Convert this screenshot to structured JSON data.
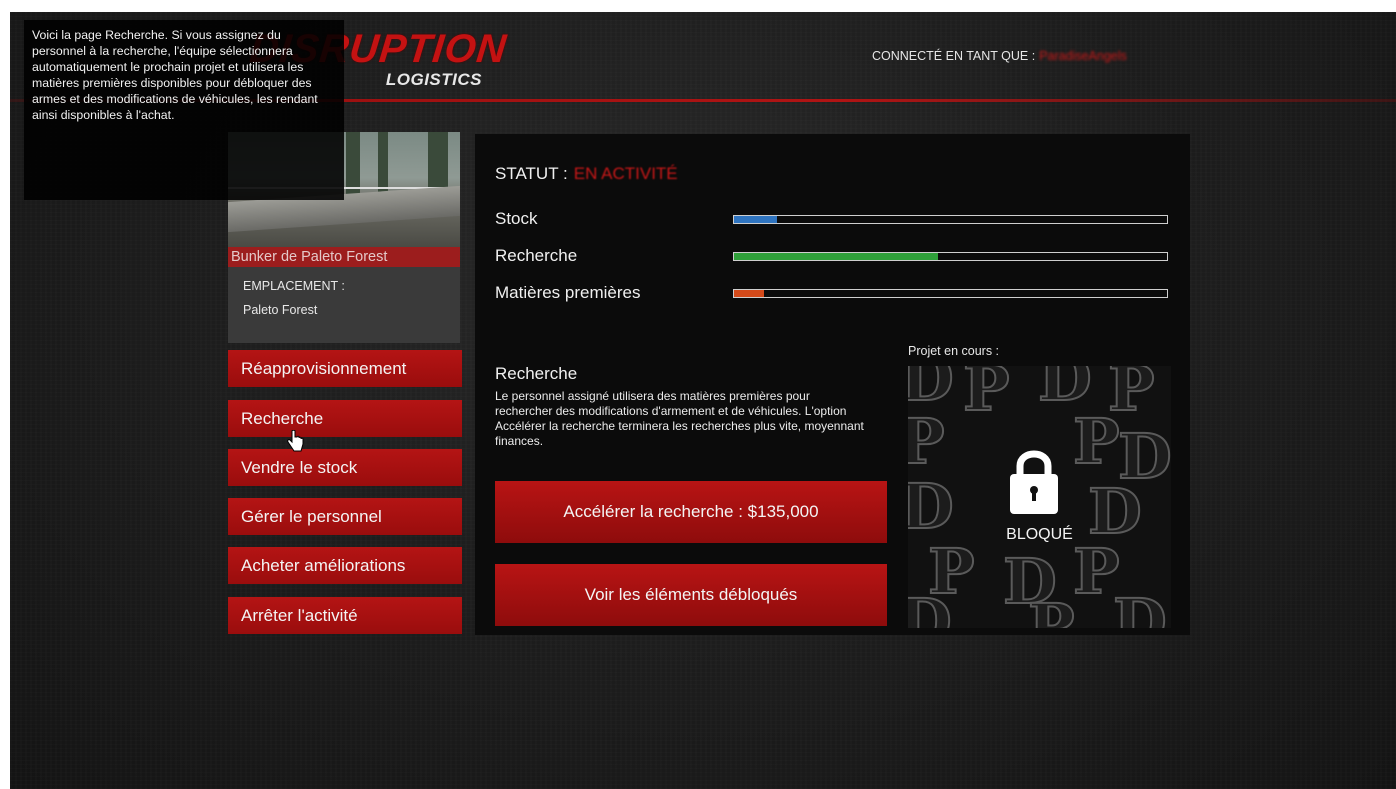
{
  "header": {
    "logo_title": "DISRUPTION",
    "logo_subtitle": "LOGISTICS",
    "logged_in_label": "CONNECTÉ EN TANT QUE :",
    "username": "ParadiseAngels"
  },
  "tooltip": {
    "text": "Voici la page Recherche. Si vous assignez du personnel à la recherche, l'équipe sélectionnera automatiquement le prochain projet et utilisera les matières premières disponibles pour débloquer des armes et des modifications de véhicules, les rendant ainsi disponibles à l'achat."
  },
  "bunker": {
    "name": "Bunker de Paleto Forest",
    "location_label": "EMPLACEMENT :",
    "location_value": "Paleto Forest"
  },
  "menu": {
    "items": [
      {
        "label": "Réapprovisionnement"
      },
      {
        "label": "Recherche"
      },
      {
        "label": "Vendre le stock"
      },
      {
        "label": "Gérer le personnel"
      },
      {
        "label": "Acheter améliorations"
      },
      {
        "label": "Arrêter l'activité"
      }
    ]
  },
  "panel": {
    "status_label": "STATUT :",
    "status_value": "EN ACTIVITÉ",
    "bars": [
      {
        "label": "Stock",
        "percent": 10,
        "color": "#2f74c0"
      },
      {
        "label": "Recherche",
        "percent": 47,
        "color": "#2fa03a"
      },
      {
        "label": "Matières premières",
        "percent": 7,
        "color": "#d44a1a"
      }
    ],
    "section_title": "Recherche",
    "section_text": "Le personnel assigné utilisera des matières premières pour rechercher des modifications d'armement et de véhicules. L'option Accélérer la recherche terminera les recherches plus vite, moyennant finances.",
    "accelerate_button": "Accélérer la recherche : $135,000",
    "unlocked_button": "Voir les éléments débloqués",
    "project_label": "Projet en cours :",
    "project_status": "BLOQUÉ"
  },
  "colors": {
    "accent_red": "#b41414",
    "status_red": "#c81818"
  },
  "icons": {
    "lock": "lock-icon",
    "cursor": "hand-cursor-icon"
  }
}
